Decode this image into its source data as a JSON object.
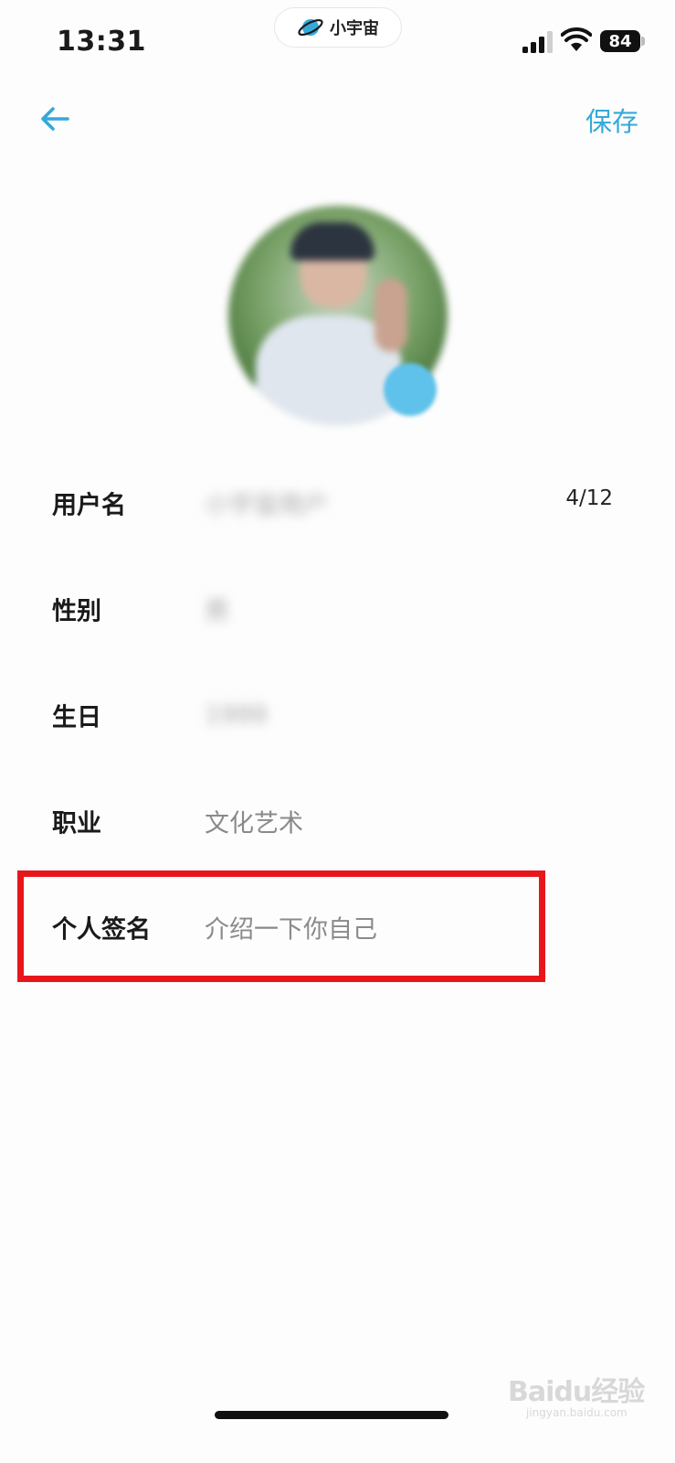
{
  "status_bar": {
    "time": "13:31",
    "app_pill": "小宇宙",
    "battery": "84"
  },
  "nav": {
    "save_label": "保存"
  },
  "form": {
    "username": {
      "label": "用户名",
      "value": "小宇宙用户",
      "counter": "4/12"
    },
    "gender": {
      "label": "性别",
      "value": "男"
    },
    "birthday": {
      "label": "生日",
      "value": "1999"
    },
    "occupation": {
      "label": "职业",
      "value": "文化艺术"
    },
    "signature": {
      "label": "个人签名",
      "placeholder": "介绍一下你自己"
    }
  },
  "watermark": {
    "brand": "Baidu经验",
    "url": "jingyan.baidu.com"
  },
  "colors": {
    "accent": "#35a9d8",
    "highlight": "#e8161b"
  }
}
